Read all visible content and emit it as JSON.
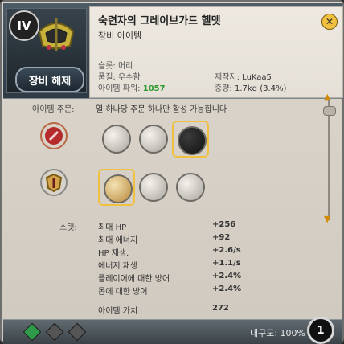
{
  "window": {
    "tier": "IV",
    "unequip_label": "장비 해제",
    "title": "숙련자의 그레이브가드 헬멧",
    "subtitle": "장비 아이템",
    "close_glyph": "✕"
  },
  "props": {
    "slot_label": "슬롯: 머리",
    "quality_label": "품질: 우수함",
    "power_label": "아이템 파워:",
    "power_value": "1057",
    "maker_label": "제작자:",
    "maker_value": "LuKaa5",
    "weight_label": "중량:",
    "weight_value": "1.7kg (3.4%)"
  },
  "orders": {
    "label": "아이템 주문:",
    "note": "열 하나당 주문 하나만 활성 가능합니다"
  },
  "stats": {
    "label": "스탯:",
    "rows": [
      {
        "name": "최대 HP",
        "value": "+256"
      },
      {
        "name": "최대 에너지",
        "value": "+92"
      },
      {
        "name": "HP 재생.",
        "value": "+2.6/s"
      },
      {
        "name": "에너지 재생",
        "value": "+1.1/s"
      },
      {
        "name": "플레이어에 대한 방어",
        "value": "+2.4%"
      },
      {
        "name": "몹에 대한 방어",
        "value": "+2.4%"
      }
    ],
    "item_value_label": "아이템 가치",
    "item_value": "272"
  },
  "footer": {
    "durability_label": "내구도: 100%",
    "badge": "1"
  },
  "colors": {
    "accent": "#f0c040",
    "green": "#2f9a2f"
  }
}
